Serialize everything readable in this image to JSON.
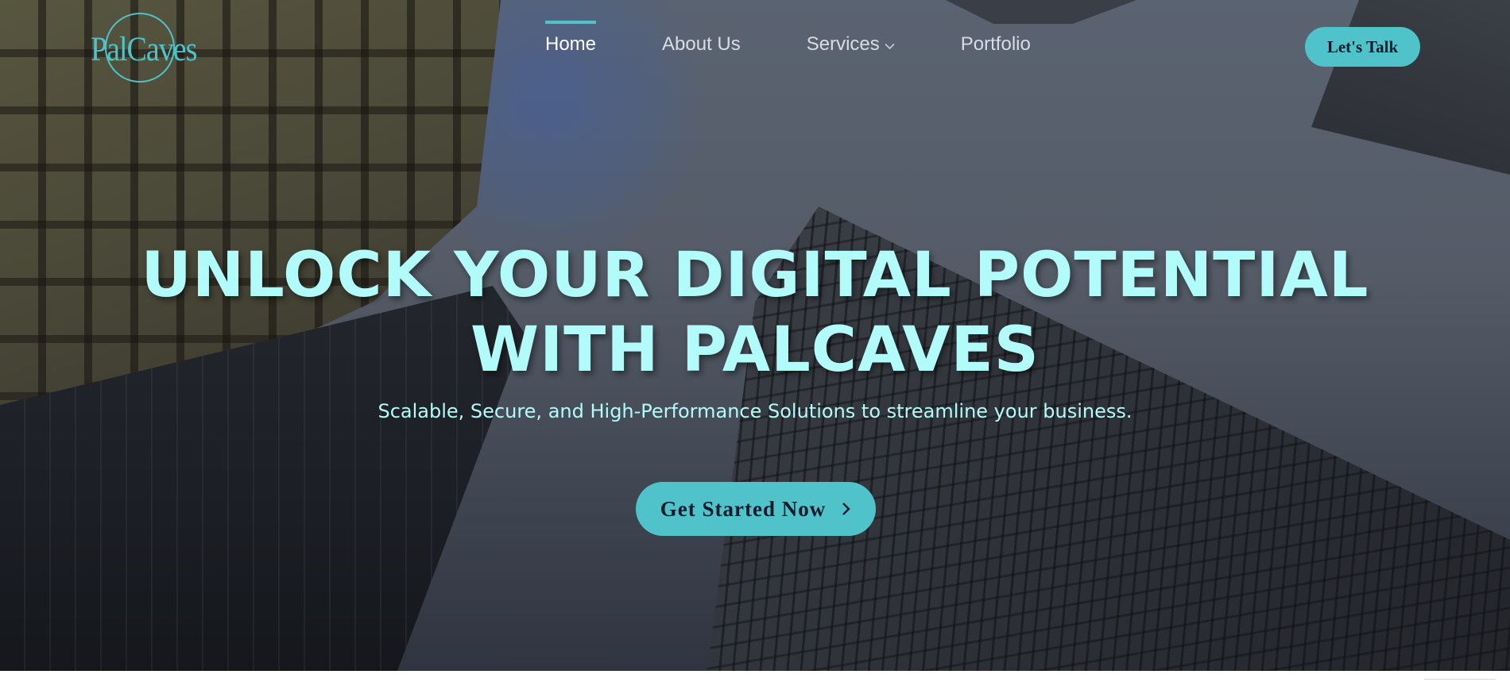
{
  "brand": {
    "logo_text": "PalCaves",
    "accent_color": "#4fc3c9",
    "headline_color": "#b2fbfb"
  },
  "nav": {
    "items": [
      {
        "label": "Home",
        "active": true
      },
      {
        "label": "About Us",
        "active": false
      },
      {
        "label": "Services",
        "active": false,
        "has_dropdown": true
      },
      {
        "label": "Portfolio",
        "active": false
      }
    ]
  },
  "header": {
    "cta_label": "Let's Talk"
  },
  "hero": {
    "title_line1": "UNLOCK YOUR DIGITAL POTENTIAL",
    "title_line2": "WITH PALCAVES",
    "subtitle": "Scalable, Secure, and High-Performance Solutions to streamline your business.",
    "cta_label": "Get Started Now",
    "cta_icon": "chevron-right-icon",
    "background": "low-angle photo of skyscrapers with dark overlay"
  }
}
